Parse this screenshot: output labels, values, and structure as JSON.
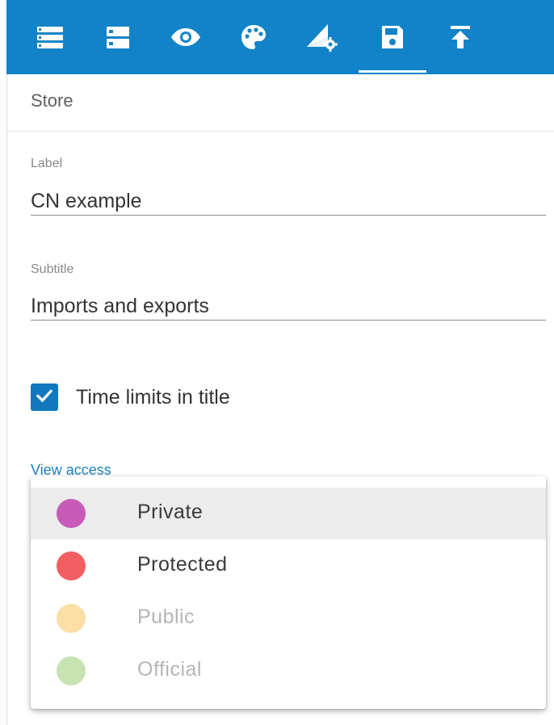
{
  "toolbar": {
    "background": "#1283c8",
    "tools": [
      {
        "icon": "list-icon"
      },
      {
        "icon": "storage-icon"
      },
      {
        "icon": "eye-icon"
      },
      {
        "icon": "palette-icon"
      },
      {
        "icon": "settings-shape-icon"
      },
      {
        "icon": "save-icon",
        "active": true
      },
      {
        "icon": "upload-icon"
      }
    ]
  },
  "section": {
    "title": "Store"
  },
  "form": {
    "label": {
      "label": "Label",
      "value": "CN example"
    },
    "subtitle": {
      "label": "Subtitle",
      "value": "Imports and exports"
    },
    "time_limits": {
      "label": "Time limits in title",
      "checked": true
    },
    "view_access": {
      "label": "View access",
      "options": [
        {
          "label": "Private",
          "color": "#c75bb7",
          "selected": true,
          "disabled": false
        },
        {
          "label": "Protected",
          "color": "#f25f63",
          "selected": false,
          "disabled": false
        },
        {
          "label": "Public",
          "color": "#fbdfa6",
          "selected": false,
          "disabled": true
        },
        {
          "label": "Official",
          "color": "#c7e3b2",
          "selected": false,
          "disabled": true
        }
      ]
    }
  }
}
